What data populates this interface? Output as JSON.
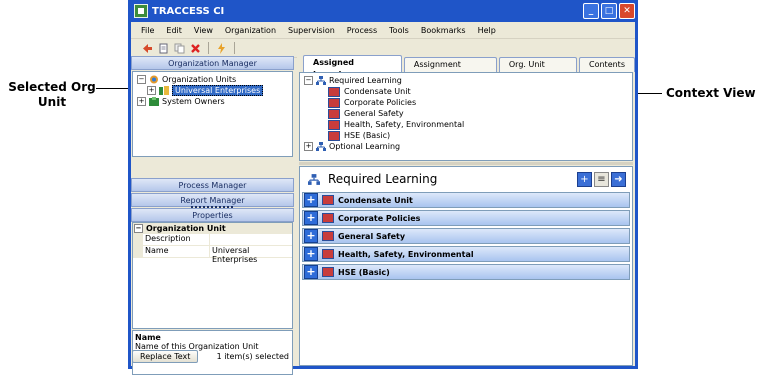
{
  "callouts": {
    "left": "Selected Org Unit",
    "right": "Context View"
  },
  "window": {
    "title": "TRACCESS CI",
    "controls": {
      "minimize": "_",
      "maximize": "□",
      "close": "✕"
    }
  },
  "menu": [
    "File",
    "Edit",
    "View",
    "Organization",
    "Supervision",
    "Process",
    "Tools",
    "Bookmarks",
    "Help"
  ],
  "toolbar": {
    "icons": [
      "back-arrow-icon",
      "new-document-icon",
      "copy-icon",
      "delete-icon",
      "lightning-icon"
    ]
  },
  "left_panel": {
    "org_manager_header": "Organization Manager",
    "tree": {
      "root": "Organization Units",
      "selected_child": "Universal Enterprises",
      "sibling": "System Owners"
    },
    "process_manager": "Process Manager",
    "report_manager": "Report Manager",
    "properties_header": "Properties",
    "properties": {
      "category": "Organization Unit",
      "rows": [
        {
          "name": "Description",
          "value": ""
        },
        {
          "name": "Name",
          "value": "Universal Enterprises"
        }
      ]
    },
    "help": {
      "title": "Name",
      "text": "Name of this Organization Unit"
    },
    "replace_button": "Replace Text",
    "status": "1 item(s) selected"
  },
  "tabs": [
    "Assigned Learning",
    "Assignment Details",
    "Org. Unit Views",
    "Contents"
  ],
  "active_tab": "Assigned Learning",
  "context_tree": {
    "root": "Required Learning",
    "children": [
      "Condensate Unit",
      "Corporate Policies",
      "General Safety",
      "Health, Safety, Environmental",
      "HSE (Basic)"
    ],
    "optional": "Optional Learning"
  },
  "content": {
    "title": "Required Learning",
    "items": [
      "Condensate Unit",
      "Corporate Policies",
      "General Safety",
      "Health, Safety, Environmental",
      "HSE (Basic)"
    ]
  },
  "colors": {
    "title_bar": "#1f55c8",
    "selection": "#316ac5",
    "accordion": "#a9c4ef"
  }
}
